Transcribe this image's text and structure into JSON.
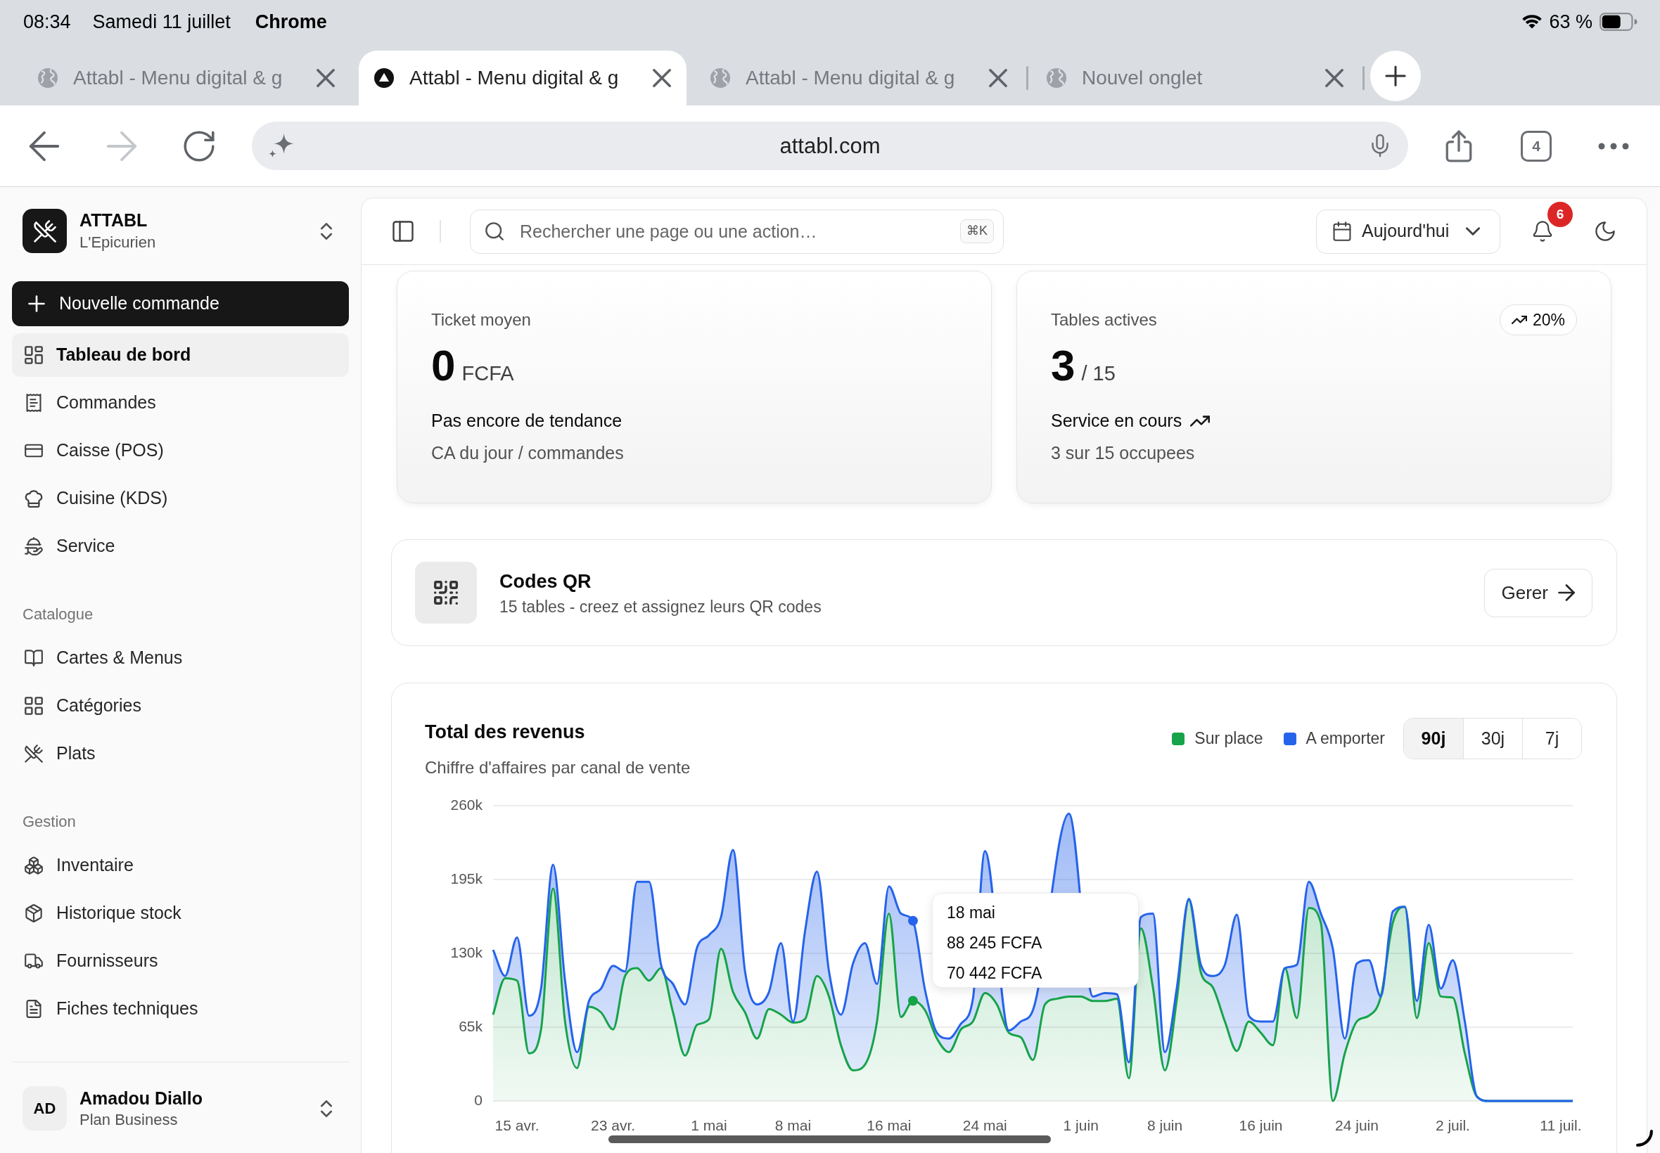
{
  "status_bar": {
    "time": "08:34",
    "date": "Samedi 11 juillet",
    "app": "Chrome",
    "battery": "63 %"
  },
  "browser": {
    "tabs": [
      {
        "title": "Attabl - Menu digital & g",
        "kind": "unloaded",
        "selected": false
      },
      {
        "title": "Attabl - Menu digital & g",
        "kind": "loaded",
        "selected": true
      },
      {
        "title": "Attabl - Menu digital & g",
        "kind": "unloaded",
        "selected": false
      },
      {
        "title": "Nouvel onglet",
        "kind": "unloaded",
        "selected": false
      }
    ],
    "back_disabled": false,
    "forward_disabled": true,
    "address": "attabl.com",
    "tab_count": "4"
  },
  "sidebar": {
    "brand": {
      "name": "ATTABL",
      "subtitle": "L'Epicurien"
    },
    "new_order": "Nouvelle commande",
    "sections": [
      {
        "items": [
          {
            "label": "Tableau de bord",
            "selected": true
          },
          {
            "label": "Commandes",
            "selected": false
          },
          {
            "label": "Caisse (POS)",
            "selected": false
          },
          {
            "label": "Cuisine (KDS)",
            "selected": false
          },
          {
            "label": "Service",
            "selected": false
          }
        ]
      },
      {
        "title": "Catalogue",
        "items": [
          {
            "label": "Cartes & Menus",
            "selected": false
          },
          {
            "label": "Catégories",
            "selected": false
          },
          {
            "label": "Plats",
            "selected": false
          }
        ]
      },
      {
        "title": "Gestion",
        "items": [
          {
            "label": "Inventaire",
            "selected": false
          },
          {
            "label": "Historique stock",
            "selected": false
          },
          {
            "label": "Fournisseurs",
            "selected": false
          },
          {
            "label": "Fiches techniques",
            "selected": false
          }
        ]
      }
    ],
    "user": {
      "initials": "AD",
      "name": "Amadou Diallo",
      "plan": "Plan Business"
    }
  },
  "header": {
    "search": {
      "placeholder": "Rechercher une page ou une action…",
      "shortcut": "⌘K"
    },
    "date_filter": "Aujourd'hui",
    "notifications": "6"
  },
  "stats": [
    {
      "kind": "neutral",
      "label": "Ticket moyen",
      "value": "0",
      "unit": "FCFA",
      "trend": "Pas encore de tendance",
      "note": "CA du jour / commandes"
    },
    {
      "kind": "up",
      "label": "Tables actives",
      "badge": "20%",
      "value": "3",
      "unit": "/ 15",
      "trend": "Service en cours",
      "note": "3 sur 15 occupees"
    }
  ],
  "qr_codes": {
    "title": "Codes QR",
    "subtitle": "15 tables - creez et assignez leurs QR codes",
    "button": "Gerer"
  },
  "revenue": {
    "title": "Total des revenus",
    "subtitle": "Chiffre d'affaires par canal de vente",
    "ranges": [
      {
        "label": "90j",
        "selected": true
      },
      {
        "label": "30j",
        "selected": false
      },
      {
        "label": "7j",
        "selected": false
      }
    ],
    "tooltip": {
      "lines": [
        "88 245 FCFA",
        "70 442 FCFA"
      ]
    },
    "chart_data": {
      "type": "area",
      "stacked": true,
      "grid": true,
      "categories": [
        null,
        null,
        "15 avr.",
        null,
        null,
        null,
        null,
        null,
        null,
        null,
        "23 avr.",
        null,
        null,
        null,
        null,
        null,
        null,
        null,
        "1 mai",
        null,
        null,
        null,
        null,
        null,
        null,
        "8 mai",
        null,
        null,
        null,
        null,
        null,
        null,
        null,
        "16 mai",
        null,
        null,
        null,
        null,
        null,
        null,
        null,
        "24 mai",
        null,
        null,
        null,
        null,
        null,
        null,
        null,
        "1 juin",
        null,
        null,
        null,
        null,
        null,
        null,
        "8 juin",
        null,
        null,
        null,
        null,
        null,
        null,
        null,
        "16 juin",
        null,
        null,
        null,
        null,
        null,
        null,
        null,
        "24 juin",
        null,
        null,
        null,
        null,
        null,
        null,
        null,
        "2 juil.",
        null,
        null,
        null,
        null,
        null,
        null,
        null,
        null,
        "11 juil.",
        null
      ],
      "ylim": [
        0,
        260000
      ],
      "yticks": [
        {
          "value": 0,
          "label": "0"
        },
        {
          "value": 65000,
          "label": "65k"
        },
        {
          "value": 130000,
          "label": "130k"
        },
        {
          "value": 195000,
          "label": "195k"
        },
        {
          "value": 260000,
          "label": "260k"
        }
      ],
      "series": [
        {
          "name": "Sur place",
          "color": "#16a34a",
          "values": [
            76000,
            108000,
            106000,
            42000,
            63000,
            187000,
            70000,
            29000,
            83000,
            78000,
            63000,
            110000,
            117000,
            106000,
            117000,
            78000,
            40000,
            67000,
            72000,
            134000,
            96000,
            78000,
            55000,
            81000,
            76000,
            69000,
            72000,
            110000,
            92000,
            49000,
            27000,
            32000,
            70000,
            165000,
            74000,
            88245,
            80000,
            55000,
            43000,
            63000,
            70000,
            95000,
            85000,
            60000,
            56000,
            36000,
            85000,
            90000,
            92000,
            92000,
            88000,
            88000,
            90000,
            20000,
            152000,
            100000,
            27000,
            90000,
            177000,
            113000,
            100000,
            70000,
            44000,
            70000,
            60000,
            49000,
            117000,
            73000,
            170000,
            157000,
            0,
            42000,
            70000,
            75000,
            92000,
            157000,
            171000,
            73000,
            139000,
            92000,
            91000,
            42000,
            4000,
            0,
            0,
            0,
            0,
            0,
            0,
            0,
            0
          ]
        },
        {
          "name": "A emporter",
          "color": "#2563eb",
          "values": [
            57000,
            2000,
            38000,
            33000,
            36000,
            21000,
            36000,
            14000,
            5000,
            21000,
            56000,
            4000,
            76000,
            87000,
            3000,
            25000,
            45000,
            68000,
            74000,
            28000,
            125000,
            36000,
            30000,
            15000,
            63000,
            1000,
            77000,
            92000,
            22000,
            27000,
            94000,
            107000,
            33000,
            24000,
            91000,
            70442,
            18000,
            5000,
            12000,
            5000,
            20000,
            125000,
            null,
            2000,
            14000,
            44000,
            null,
            null,
            161000,
            null,
            4000,
            7000,
            4000,
            14000,
            10000,
            65000,
            16000,
            10000,
            1000,
            7000,
            10000,
            50000,
            120000,
            5000,
            10000,
            21000,
            0,
            47000,
            23000,
            8000,
            134000,
            13000,
            51000,
            49000,
            0,
            10000,
            0,
            15000,
            16000,
            7000,
            33000,
            28000,
            0,
            0,
            0,
            0,
            0,
            0,
            0,
            0,
            0
          ]
        }
      ],
      "annotations": [
        "18 mai"
      ]
    }
  }
}
